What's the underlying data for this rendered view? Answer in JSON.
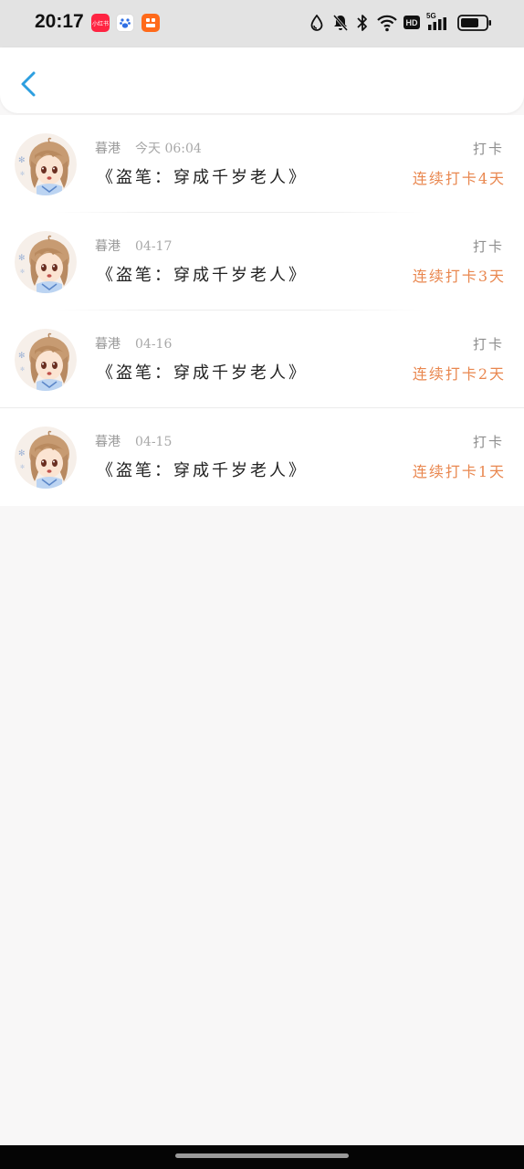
{
  "status_bar": {
    "time": "20:17",
    "apps": [
      {
        "name": "xiaohongshu",
        "label": "小红书",
        "color": "#ff2442"
      },
      {
        "name": "baidu",
        "label": "du",
        "color": "#ffffff"
      },
      {
        "name": "app-orange",
        "label": "",
        "color": "#ff6a1a"
      }
    ],
    "indicators": [
      "water-drop-icon",
      "mute-bell-icon",
      "bluetooth-icon",
      "wifi-icon",
      "hd-icon",
      "signal-5g-icon",
      "battery-icon"
    ],
    "hd_label": "HD",
    "network_label": "5G"
  },
  "header": {
    "back_icon": "chevron-left-icon",
    "accent_color": "#2d9fe0"
  },
  "checkins": [
    {
      "user": "暮港",
      "time": "今天 06:04",
      "title": "《盗笔：穿成千岁老人》",
      "action": "打卡",
      "streak": "连续打卡4天"
    },
    {
      "user": "暮港",
      "time": "04-17",
      "title": "《盗笔：穿成千岁老人》",
      "action": "打卡",
      "streak": "连续打卡3天"
    },
    {
      "user": "暮港",
      "time": "04-16",
      "title": "《盗笔：穿成千岁老人》",
      "action": "打卡",
      "streak": "连续打卡2天"
    },
    {
      "user": "暮港",
      "time": "04-15",
      "title": "《盗笔：穿成千岁老人》",
      "action": "打卡",
      "streak": "连续打卡1天"
    }
  ],
  "colors": {
    "streak": "#e9874f",
    "muted_text": "#9a9a9a",
    "page_bg": "#f8f7f7"
  }
}
